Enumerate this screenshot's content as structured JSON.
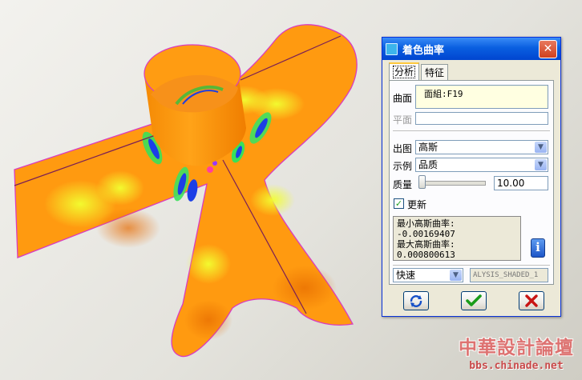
{
  "dialog": {
    "title": "着色曲率",
    "close_symbol": "✕",
    "tabs": [
      {
        "label": "分析",
        "active": true
      },
      {
        "label": "特征",
        "active": false
      }
    ],
    "surface_label": "曲面",
    "surface_value": "面組:F19",
    "plane_label": "平面",
    "plane_value": "",
    "display_label": "出图",
    "display_value": "高斯",
    "example_label": "示例",
    "example_value": "品质",
    "quality_label": "质量",
    "quality_value": "10.00",
    "quality_fraction": 0.0,
    "update_label": "更新",
    "update_checked": true,
    "result_line1": "最小高斯曲率: -0.00169407",
    "result_line2": "最大高斯曲率: 0.000800613",
    "mode_value": "快速",
    "name_value": "ALYSIS_SHADED_1"
  },
  "watermark": {
    "title": "中華設計論壇",
    "url": "bbs.chinade.net"
  },
  "icons": {
    "window": "window-icon",
    "info": "info-icon",
    "repeat": "repeat-icon",
    "ok": "checkmark-icon",
    "cancel": "cancel-x-icon"
  },
  "colors": {
    "surface_base": "#ff9a10",
    "title_bar": "#0a5fe0",
    "ok_green": "#1a9c1a",
    "cancel_red": "#c81414"
  }
}
